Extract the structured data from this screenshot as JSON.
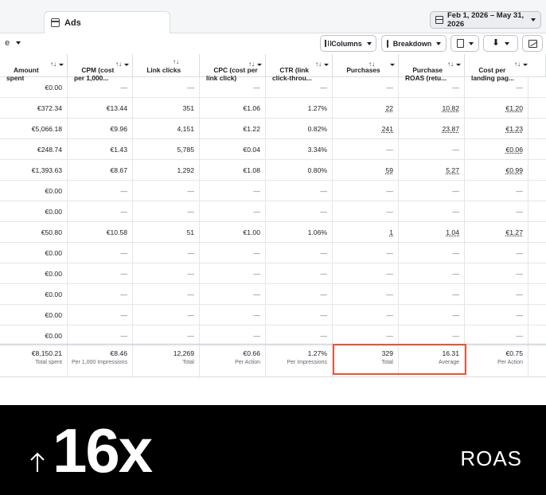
{
  "tab": {
    "label": "Ads"
  },
  "date_range": {
    "label": "Feb 1, 2026 – May 31, 2026"
  },
  "toolbar": {
    "left_partial": "e",
    "columns_label": "Columns",
    "breakdown_label": "Breakdown"
  },
  "table": {
    "headers": [
      "Amount\nspent",
      "CPM (cost\nper 1,000...",
      "Link clicks",
      "CPC (cost per\nlink click)",
      "CTR (link\nclick-throu...",
      "Purchases",
      "Purchase\nROAS (retu...",
      "Cost per\nlanding pag..."
    ],
    "rows": [
      [
        "€0.00",
        "—",
        "—",
        "—",
        "—",
        "—",
        "—",
        "—"
      ],
      [
        "€372.34",
        "€13.44",
        "351",
        "€1.06",
        "1.27%",
        "22",
        "10.82",
        "€1.20"
      ],
      [
        "€5,066.18",
        "€9.96",
        "4,151",
        "€1.22",
        "0.82%",
        "241",
        "23.87",
        "€1.23"
      ],
      [
        "€248.74",
        "€1.43",
        "5,785",
        "€0.04",
        "3.34%",
        "—",
        "—",
        "€0.06"
      ],
      [
        "€1,393.63",
        "€8.67",
        "1,292",
        "€1.08",
        "0.80%",
        "59",
        "5.27",
        "€0.99"
      ],
      [
        "€0.00",
        "—",
        "—",
        "—",
        "—",
        "—",
        "—",
        "—"
      ],
      [
        "€0.00",
        "—",
        "—",
        "—",
        "—",
        "—",
        "—",
        "—"
      ],
      [
        "€50.80",
        "€10.58",
        "51",
        "€1.00",
        "1.06%",
        "1",
        "1.04",
        "€1.27"
      ],
      [
        "€0.00",
        "—",
        "—",
        "—",
        "—",
        "—",
        "—",
        "—"
      ],
      [
        "€0.00",
        "—",
        "—",
        "—",
        "—",
        "—",
        "—",
        "—"
      ],
      [
        "€0.00",
        "—",
        "—",
        "—",
        "—",
        "—",
        "—",
        "—"
      ],
      [
        "€0.00",
        "—",
        "—",
        "—",
        "—",
        "—",
        "—",
        "—"
      ],
      [
        "€0.00",
        "—",
        "—",
        "—",
        "—",
        "—",
        "—",
        "—"
      ]
    ],
    "totals": [
      {
        "value": "€8,150.21",
        "label": "Total spent"
      },
      {
        "value": "€8.46",
        "label": "Per 1,000 Impressions"
      },
      {
        "value": "12,269",
        "label": "Total"
      },
      {
        "value": "€0.66",
        "label": "Per Action"
      },
      {
        "value": "1.27%",
        "label": "Per Impressions"
      },
      {
        "value": "329",
        "label": "Total"
      },
      {
        "value": "16.31",
        "label": "Average"
      },
      {
        "value": "€0.75",
        "label": "Per Action"
      }
    ]
  },
  "banner": {
    "headline": "16x",
    "metric": "ROAS"
  },
  "colors": {
    "highlight": "#e8563a",
    "banner_bg": "#000000",
    "banner_text": "#ffffff"
  }
}
